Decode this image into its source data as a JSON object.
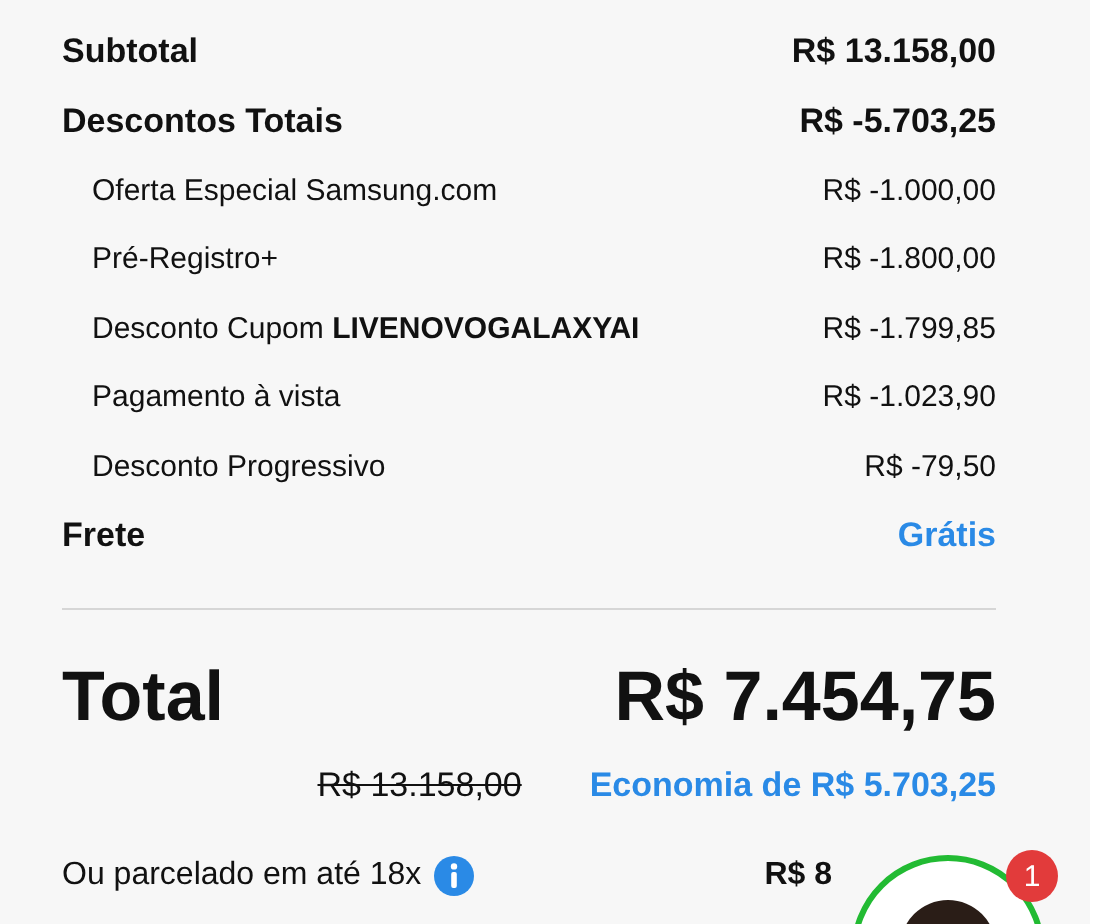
{
  "summary": {
    "lines": [
      {
        "kind": "heading",
        "label": "Subtotal",
        "value": "R$ 13.158,00"
      },
      {
        "kind": "heading",
        "label": "Descontos Totais",
        "value": "R$ -5.703,25"
      },
      {
        "kind": "item",
        "label": "Oferta Especial Samsung.com",
        "value": "R$ -1.000,00"
      },
      {
        "kind": "item",
        "label": "Pré-Registro+",
        "value": "R$ -1.800,00"
      },
      {
        "kind": "item",
        "label": "Desconto Cupom **LIVENOVOGALAXYAI**",
        "value": "R$ -1.799,85"
      },
      {
        "kind": "item",
        "label": "Pagamento à vista",
        "value": "R$ -1.023,90"
      },
      {
        "kind": "item",
        "label": "Desconto Progressivo",
        "value": "R$ -79,50"
      },
      {
        "kind": "link",
        "label": "Frete",
        "value": "Grátis"
      }
    ]
  },
  "total": {
    "label": "Total",
    "value": "R$ 7.454,75",
    "original_price": "R$ 13.158,00",
    "savings": "Economia de R$ 5.703,25"
  },
  "installments": {
    "label": "Ou parcelado em até 18x",
    "value": "R$ 8"
  },
  "chat": {
    "badge": "1"
  }
}
